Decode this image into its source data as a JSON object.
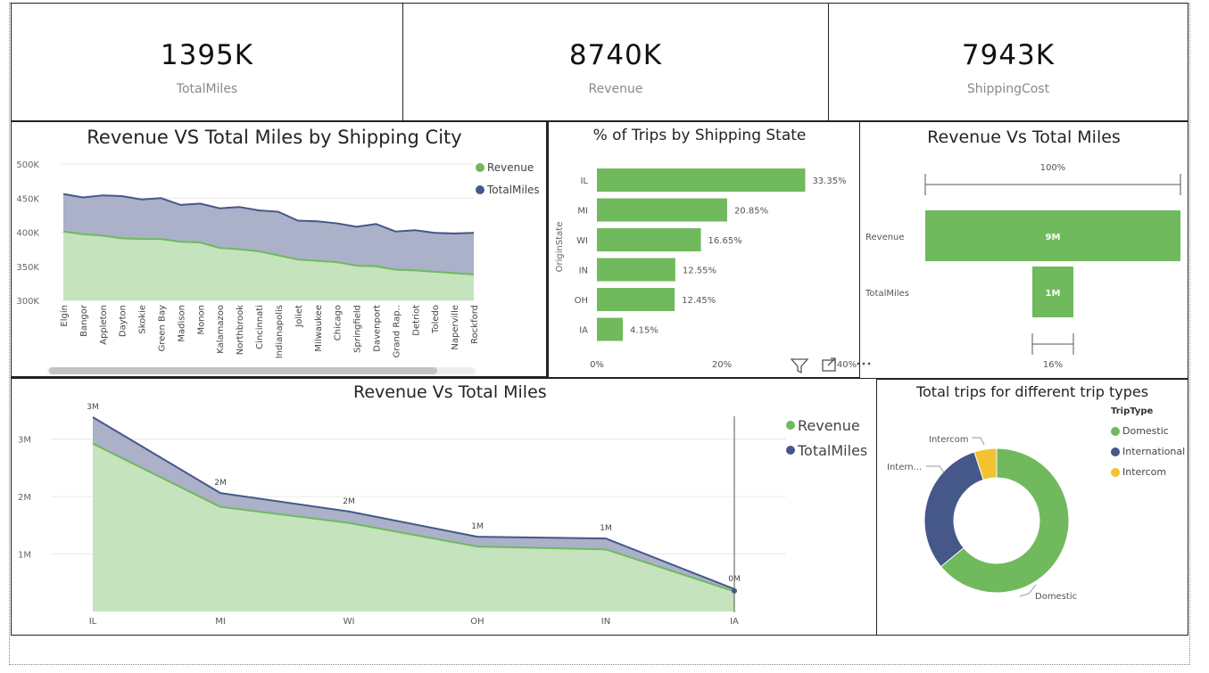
{
  "colors": {
    "revenue": "#70b95d",
    "revenue_fill": "#c5e3bd",
    "miles": "#46588a",
    "miles_fill": "#aab1c8",
    "intercom": "#f2c230",
    "grid": "#e8e8e8",
    "axis_text": "#666666"
  },
  "kpis": [
    {
      "value": "1395K",
      "label": "TotalMiles"
    },
    {
      "value": "8740K",
      "label": "Revenue"
    },
    {
      "value": "7943K",
      "label": "ShippingCost"
    }
  ],
  "city_chart": {
    "title": "Revenue VS Total Miles by Shipping City"
  },
  "state_chart": {
    "title": "% of Trips by Shipping State",
    "ylabel": "OriginState"
  },
  "funnel_chart": {
    "title": "Revenue Vs Total Miles",
    "top_label": "100%",
    "bottom_label": "16%"
  },
  "state_area_chart": {
    "title": "Revenue Vs Total Miles"
  },
  "donut_chart": {
    "title": "Total trips for different trip types",
    "legend_title": "TripType"
  },
  "icons": {
    "filter": "filter-icon",
    "focus": "focus-mode-icon",
    "more": "more-options-icon"
  },
  "chart_data": [
    {
      "type": "area",
      "title": "Revenue VS Total Miles by Shipping City",
      "categories": [
        "Elgin",
        "Bangor",
        "Appleton",
        "Dayton",
        "Skokie",
        "Green Bay",
        "Madison",
        "Monon",
        "Kalamazoo",
        "Northbrook",
        "Cincinnati",
        "Indianapolis",
        "Joliet",
        "Milwaukee",
        "Chicago",
        "Springfield",
        "Davenport",
        "Grand Rap..",
        "Detriot",
        "Toledo",
        "Naperville",
        "Rockford"
      ],
      "series": [
        {
          "name": "Revenue",
          "values": [
            401000,
            397000,
            395000,
            391000,
            390000,
            390000,
            386000,
            385000,
            377000,
            375000,
            372000,
            366000,
            360000,
            358000,
            356000,
            351000,
            350000,
            345000,
            344000,
            342000,
            340000,
            338000
          ]
        },
        {
          "name": "TotalMiles",
          "values": [
            456000,
            451000,
            454000,
            453000,
            448000,
            450000,
            440000,
            442000,
            435000,
            437000,
            432000,
            430000,
            417000,
            416000,
            413000,
            408000,
            412000,
            401000,
            403000,
            399000,
            398000,
            399000
          ]
        }
      ],
      "yticks": [
        "500K",
        "450K",
        "400K",
        "350K",
        "300K"
      ],
      "ylim": [
        300000,
        500000
      ],
      "legend": [
        "Revenue",
        "TotalMiles"
      ],
      "legend_position": "top-right"
    },
    {
      "type": "bar",
      "title": "% of Trips by Shipping State",
      "orientation": "horizontal",
      "categories": [
        "IL",
        "MI",
        "WI",
        "IN",
        "OH",
        "IA"
      ],
      "values": [
        33.35,
        20.85,
        16.65,
        12.55,
        12.45,
        4.15
      ],
      "value_labels": [
        "33.35%",
        "20.85%",
        "16.65%",
        "12.55%",
        "12.45%",
        "4.15%"
      ],
      "xticks": [
        "0%",
        "20%",
        "40%"
      ],
      "xlim": [
        0,
        40
      ],
      "ylabel": "OriginState"
    },
    {
      "type": "bar",
      "subtype": "funnel",
      "title": "Revenue Vs Total Miles",
      "categories": [
        "Revenue",
        "TotalMiles"
      ],
      "values": [
        8740000,
        1395000
      ],
      "value_labels": [
        "9M",
        "1M"
      ],
      "relative_percent": [
        100,
        16
      ]
    },
    {
      "type": "area",
      "title": "Revenue Vs Total Miles",
      "categories": [
        "IL",
        "MI",
        "WI",
        "OH",
        "IN",
        "IA"
      ],
      "series": [
        {
          "name": "Revenue",
          "values": [
            2920000,
            1820000,
            1540000,
            1130000,
            1080000,
            350000
          ]
        },
        {
          "name": "TotalMiles",
          "values": [
            3380000,
            2060000,
            1740000,
            1300000,
            1270000,
            390000
          ]
        }
      ],
      "data_labels": [
        "3M",
        "2M",
        "2M",
        "1M",
        "1M",
        "0M"
      ],
      "yticks": [
        "3M",
        "2M",
        "1M"
      ],
      "ylim": [
        0,
        3700000
      ],
      "legend": [
        "Revenue",
        "TotalMiles"
      ],
      "legend_position": "top-right"
    },
    {
      "type": "pie",
      "subtype": "donut",
      "title": "Total trips for different trip types",
      "categories": [
        "Domestic",
        "International",
        "Intercom"
      ],
      "values": [
        64,
        31,
        5
      ],
      "legend_title": "TripType",
      "slice_labels": [
        "Domestic",
        "Intern...",
        "Intercom"
      ]
    }
  ]
}
